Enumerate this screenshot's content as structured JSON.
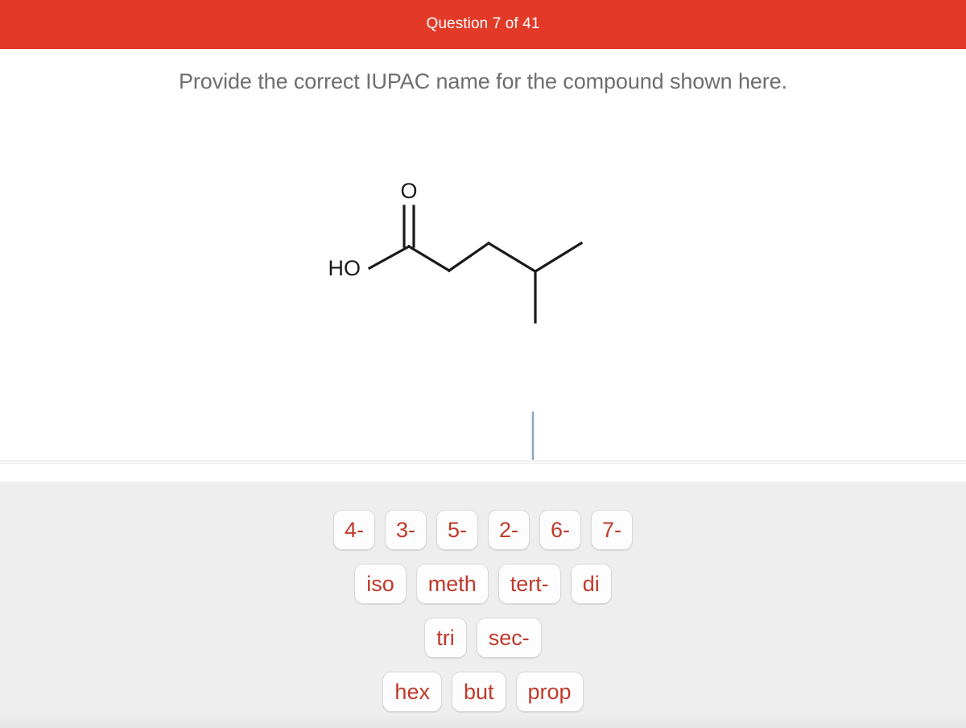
{
  "header": {
    "title": "Question 7 of 41",
    "background_color": "#e33a28",
    "text_color": "#ffffff"
  },
  "prompt": {
    "text": "Provide the correct IUPAC name for the compound shown here.",
    "color": "#6e6e6e"
  },
  "structure": {
    "name": "chemical-structure-diagram",
    "labels": {
      "hydroxyl": "HO",
      "carbonyl_oxygen": "O"
    },
    "description": "Skeletal structure of a carboxylic acid: HO-C(=O)-CH2-CH2-CH(CH3)-CH3",
    "line_color": "#1a1a1a"
  },
  "answer": {
    "value": "",
    "caret_color": "#8fa9bd"
  },
  "tray": {
    "background_color": "#eeeeee",
    "tile_text_color": "#c0392b",
    "tile_background_color": "#fdfdfd",
    "rows": [
      {
        "tiles": [
          "4-",
          "3-",
          "5-",
          "2-",
          "6-",
          "7-"
        ]
      },
      {
        "tiles": [
          "iso",
          "meth",
          "tert-",
          "di"
        ]
      },
      {
        "tiles": [
          "tri",
          "sec-"
        ]
      },
      {
        "tiles": [
          "hex",
          "but",
          "prop"
        ]
      }
    ]
  }
}
